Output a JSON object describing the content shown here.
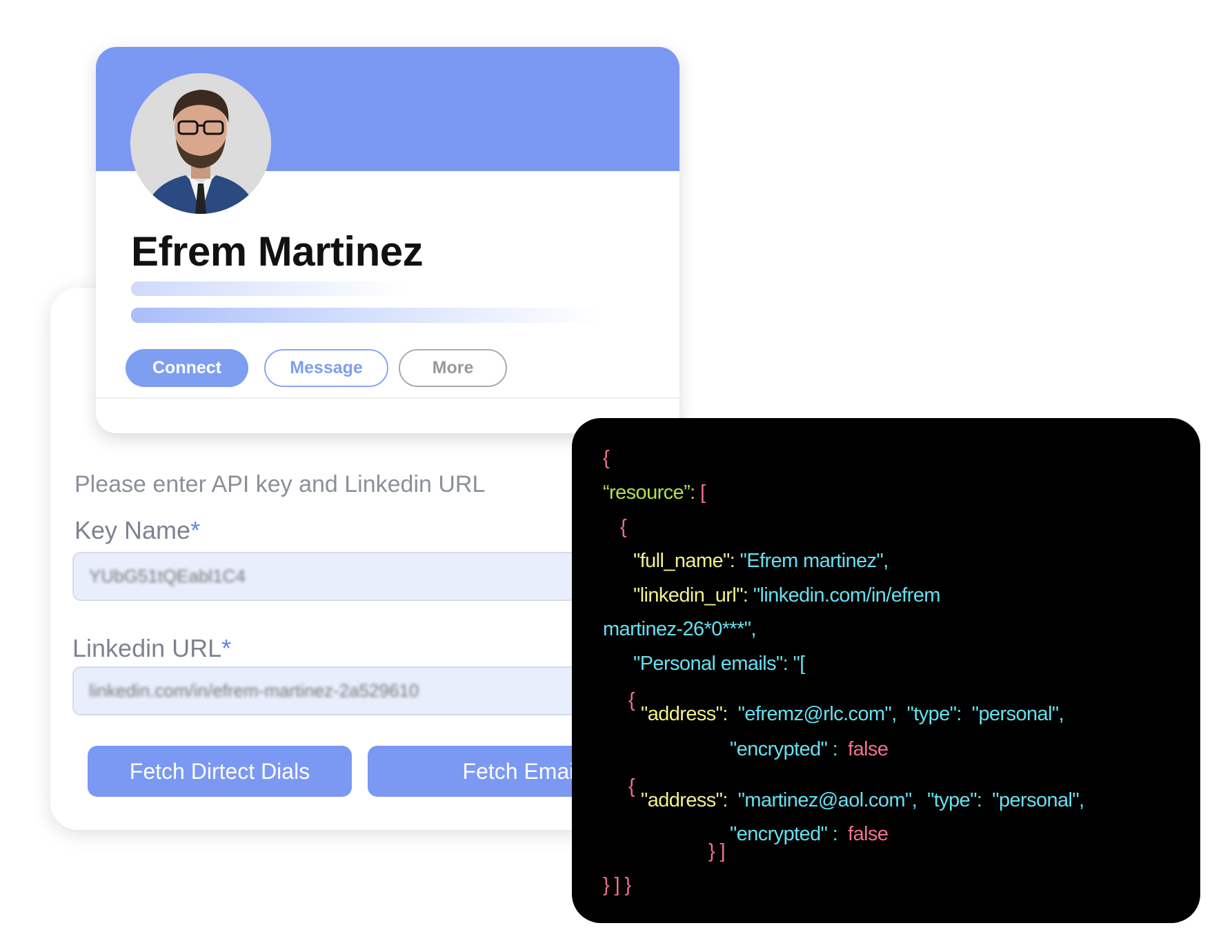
{
  "profile": {
    "name": "Efrem Martinez",
    "buttons": {
      "connect": "Connect",
      "message": "Message",
      "more": "More"
    }
  },
  "form": {
    "heading": "Please enter API key and Linkedin URL",
    "key_label": "Key Name",
    "url_label": "Linkedin URL",
    "required_mark": "*",
    "key_value": "YUbG51tQEabl1C4",
    "url_value": "linkedin.com/in/efrem-martinez-2a529610",
    "fetch_dials": "Fetch Dirtect Dials",
    "fetch_emails": "Fetch Emails"
  },
  "code": {
    "open": "{",
    "resource_key": "“resource”:",
    "bracket_open": " [",
    "obj_open": "{",
    "full_name_key": "\"full_name\":",
    "full_name_val": " \"Efrem martinez\",",
    "linkedin_key": "\"linkedin_url\":",
    "linkedin_val1": " \"linkedin.com/in/efrem",
    "linkedin_val2": "martinez-26*0***\",",
    "emails_key": "\"Personal emails\": \"[",
    "e1_brace": "{",
    "e1_addr_key": "\"address\":",
    "e1_addr_val": "  \"efremz@rlc.com\",  \"type\":  \"personal\",",
    "e1_enc_key": "\"encrypted\" :",
    "e1_enc_val": "  false",
    "e2_brace": "{",
    "e2_addr_key": "\"address\":",
    "e2_addr_val": "  \"martinez@aol.com\",  \"type\":  \"personal\",",
    "e2_enc_key": "\"encrypted\" :",
    "e2_enc_val": "  false",
    "inner_close": "} ]",
    "close": "} ] }"
  },
  "colors": {
    "accent": "#7b98f3",
    "brace": "#f2718f",
    "resource": "#b5e04a",
    "key": "#f3f08f",
    "value": "#66e0f0"
  }
}
